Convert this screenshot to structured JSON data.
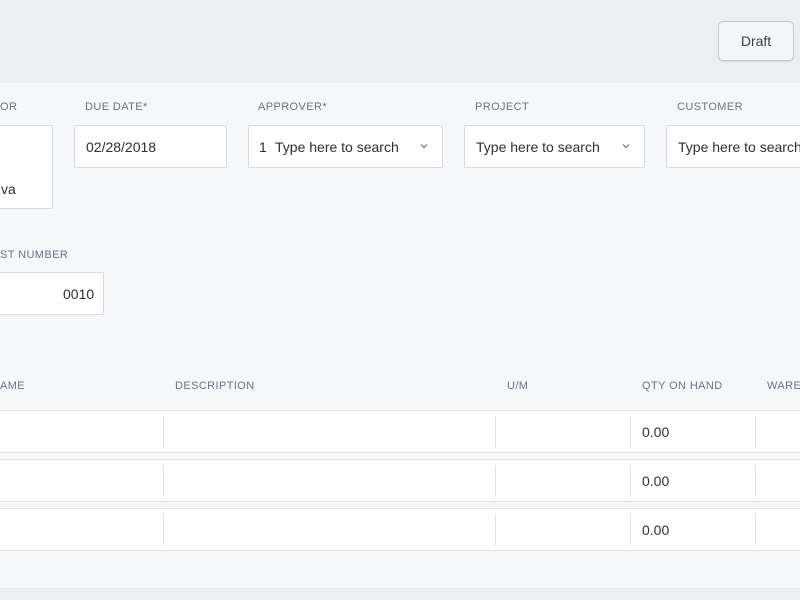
{
  "header": {
    "status_button": "Draft"
  },
  "form": {
    "vendor": {
      "label": "OR",
      "value": "va"
    },
    "due_date": {
      "label": "DUE DATE*",
      "value": "02/28/2018"
    },
    "approver": {
      "label": "APPROVER*",
      "count": "1",
      "placeholder": "Type here to search"
    },
    "project": {
      "label": "PROJECT",
      "placeholder": "Type here to search"
    },
    "customer": {
      "label": "CUSTOMER",
      "placeholder": "Type here to search"
    },
    "request_number": {
      "label": "ST NUMBER",
      "value": "0010"
    }
  },
  "table": {
    "columns": [
      "AME",
      "DESCRIPTION",
      "U/M",
      "QTY ON HAND",
      "WARE"
    ],
    "rows": [
      {
        "qty_on_hand": "0.00"
      },
      {
        "qty_on_hand": "0.00"
      },
      {
        "qty_on_hand": "0.00"
      }
    ]
  },
  "icons": {
    "dropdown": "chevron-down-icon"
  }
}
